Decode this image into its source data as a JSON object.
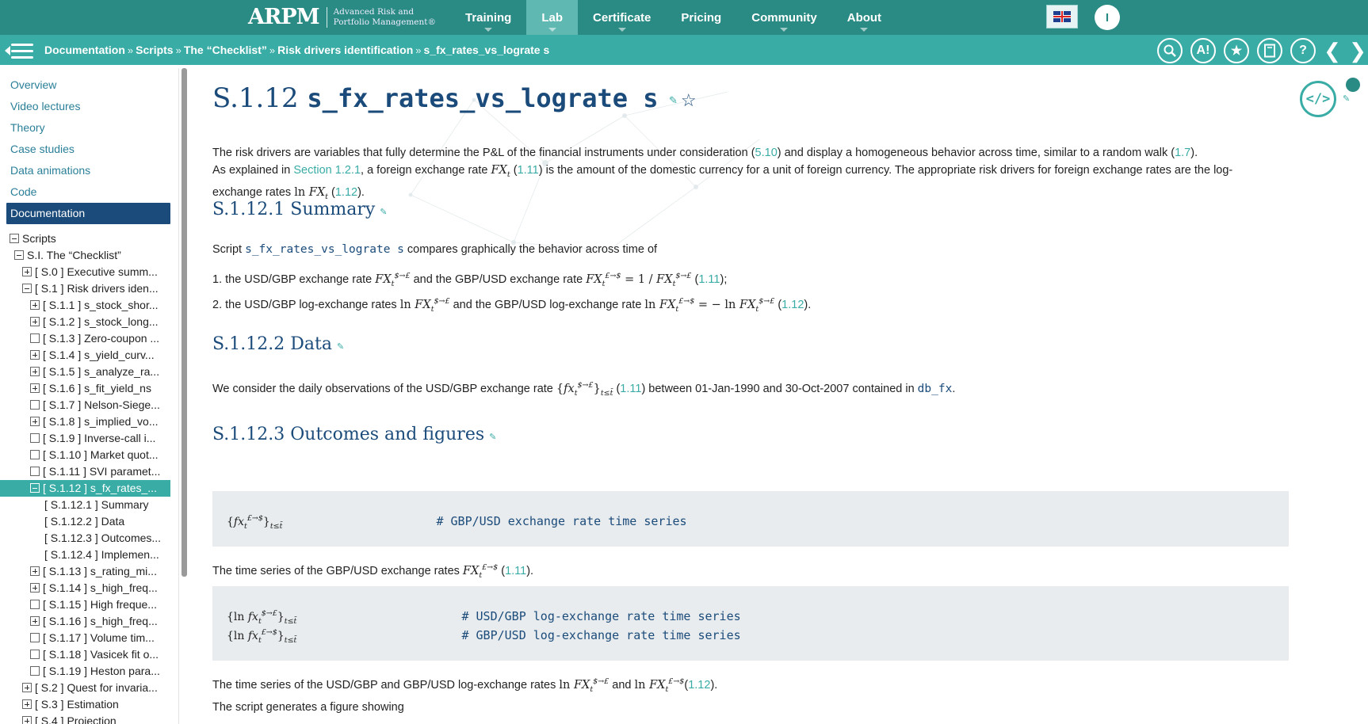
{
  "topbar": {
    "logo": {
      "mark": "ARPM",
      "line1": "Advanced Risk and",
      "line2": "Portfolio Management®"
    },
    "nav": [
      {
        "label": "Training",
        "active": false,
        "caret": true
      },
      {
        "label": "Lab",
        "active": true,
        "caret": true
      },
      {
        "label": "Certificate",
        "active": false,
        "caret": true
      },
      {
        "label": "Pricing",
        "active": false,
        "caret": false
      },
      {
        "label": "Community",
        "active": false,
        "caret": true
      },
      {
        "label": "About",
        "active": false,
        "caret": true
      }
    ],
    "language_icon": "uk-flag-icon",
    "user_initial": "I"
  },
  "breadcrumb": {
    "items": [
      "Documentation",
      "Scripts",
      "The “Checklist”",
      "Risk drivers identification",
      "s_fx_rates_vs_lograte s"
    ],
    "separator": "»",
    "tools": [
      "search-icon",
      "accessibility-icon",
      "star-icon",
      "bookmark-book-icon",
      "help-icon"
    ]
  },
  "sidebar": {
    "links": [
      {
        "label": "Overview",
        "active": false
      },
      {
        "label": "Video lectures",
        "active": false
      },
      {
        "label": "Theory",
        "active": false
      },
      {
        "label": "Case studies",
        "active": false
      },
      {
        "label": "Data animations",
        "active": false
      },
      {
        "label": "Code",
        "active": false
      },
      {
        "label": "Documentation",
        "active": true
      }
    ],
    "tree": [
      {
        "indent": 0,
        "box": "minus",
        "label": "Scripts"
      },
      {
        "indent": 1,
        "box": "minus",
        "label": "S.I. The “Checklist”"
      },
      {
        "indent": 2,
        "box": "plus",
        "label": "[ S.0 ] Executive summ..."
      },
      {
        "indent": 2,
        "box": "minus",
        "label": "[ S.1 ] Risk drivers iden..."
      },
      {
        "indent": 3,
        "box": "plus",
        "label": "[ S.1.1 ] s_stock_shor..."
      },
      {
        "indent": 3,
        "box": "plus",
        "label": "[ S.1.2 ] s_stock_long..."
      },
      {
        "indent": 3,
        "box": "empty",
        "label": "[ S.1.3 ] Zero-coupon ..."
      },
      {
        "indent": 3,
        "box": "plus",
        "label": "[ S.1.4 ] s_yield_curv..."
      },
      {
        "indent": 3,
        "box": "plus",
        "label": "[ S.1.5 ] s_analyze_ra..."
      },
      {
        "indent": 3,
        "box": "plus",
        "label": "[ S.1.6 ] s_fit_yield_ns"
      },
      {
        "indent": 3,
        "box": "empty",
        "label": "[ S.1.7 ] Nelson-Siege..."
      },
      {
        "indent": 3,
        "box": "plus",
        "label": "[ S.1.8 ] s_implied_vo..."
      },
      {
        "indent": 3,
        "box": "empty",
        "label": "[ S.1.9 ] Inverse-call i..."
      },
      {
        "indent": 3,
        "box": "empty",
        "label": "[ S.1.10 ] Market quot..."
      },
      {
        "indent": 3,
        "box": "empty",
        "label": "[ S.1.11 ] SVI paramet..."
      },
      {
        "indent": 3,
        "box": "minus",
        "label": "[ S.1.12 ] s_fx_rates_...",
        "selected": true
      },
      {
        "indent": 4,
        "box": "none",
        "label": "[ S.1.12.1 ] Summary"
      },
      {
        "indent": 4,
        "box": "none",
        "label": "[ S.1.12.2 ] Data"
      },
      {
        "indent": 4,
        "box": "none",
        "label": "[ S.1.12.3 ] Outcomes..."
      },
      {
        "indent": 4,
        "box": "none",
        "label": "[ S.1.12.4 ] Implemen..."
      },
      {
        "indent": 3,
        "box": "plus",
        "label": "[ S.1.13 ] s_rating_mi..."
      },
      {
        "indent": 3,
        "box": "plus",
        "label": "[ S.1.14 ] s_high_freq..."
      },
      {
        "indent": 3,
        "box": "empty",
        "label": "[ S.1.15 ] High freque..."
      },
      {
        "indent": 3,
        "box": "plus",
        "label": "[ S.1.16 ] s_high_freq..."
      },
      {
        "indent": 3,
        "box": "empty",
        "label": "[ S.1.17 ] Volume tim..."
      },
      {
        "indent": 3,
        "box": "empty",
        "label": "[ S.1.18 ] Vasicek fit o..."
      },
      {
        "indent": 3,
        "box": "empty",
        "label": "[ S.1.19 ] Heston para..."
      },
      {
        "indent": 2,
        "box": "plus",
        "label": "[ S.2 ] Quest for invaria..."
      },
      {
        "indent": 2,
        "box": "plus",
        "label": "[ S.3 ] Estimation"
      },
      {
        "indent": 2,
        "box": "plus",
        "label": "[ S.4 ] Projection"
      }
    ]
  },
  "content": {
    "title_prefix": "S.1.12",
    "title_code": "s_fx_rates_vs_lograte s",
    "intro": {
      "p1_a": "The risk drivers are variables that fully determine the P&L of the financial instruments under consideration (",
      "p1_ref1": "5.10",
      "p1_b": ") and display a homogeneous behavior across time, similar to a random walk (",
      "p1_ref2": "1.7",
      "p1_c": ").",
      "p2_a": "As explained in ",
      "p2_link": "Section 1.2.1",
      "p2_b": ", a foreign exchange rate ",
      "p2_ref": "1.11",
      "p2_c": " is the amount of the domestic currency for a unit of foreign currency. The appropriate risk drivers for foreign exchange rates are the log-",
      "p3_a": "exchange rates ",
      "p3_ref": "1.12",
      "p3_c": ")."
    },
    "summary": {
      "heading": "S.1.12.1 Summary",
      "text_a": "Script ",
      "text_code": "s_fx_rates_vs_lograte s",
      "text_b": " compares graphically the behavior across time of",
      "item1_a": "1.  the USD/GBP exchange rate ",
      "item1_b": " and the GBP/USD exchange rate ",
      "item1_ref": "1.11",
      "item1_c": ");",
      "item2_a": "2.  the USD/GBP log-exchange rates ",
      "item2_b": " and the GBP/USD log-exchange rate ",
      "item2_ref": "1.12",
      "item2_c": ")."
    },
    "data": {
      "heading": "S.1.12.2 Data",
      "text_a": "We consider the daily observations of the USD/GBP exchange rate ",
      "text_ref": "1.11",
      "text_b": ") between 01-Jan-1990 and 30-Oct-2007 contained in ",
      "text_code": "db_fx",
      "text_c": "."
    },
    "outcomes": {
      "heading": "S.1.12.3 Outcomes and figures",
      "block1_comment": "# GBP/USD exchange rate time series",
      "after1_a": "The time series of the GBP/USD exchange rates ",
      "after1_ref": "1.11",
      "after1_b": ").",
      "block2_comment1": "# USD/GBP log-exchange rate time series",
      "block2_comment2": "# GBP/USD log-exchange rate time series",
      "after2_a": "The time series of the USD/GBP and GBP/USD log-exchange rates ",
      "after2_mid": " and ",
      "after2_ref": "1.12",
      "after2_b": ").",
      "after3": "The script generates a figure showing"
    }
  }
}
